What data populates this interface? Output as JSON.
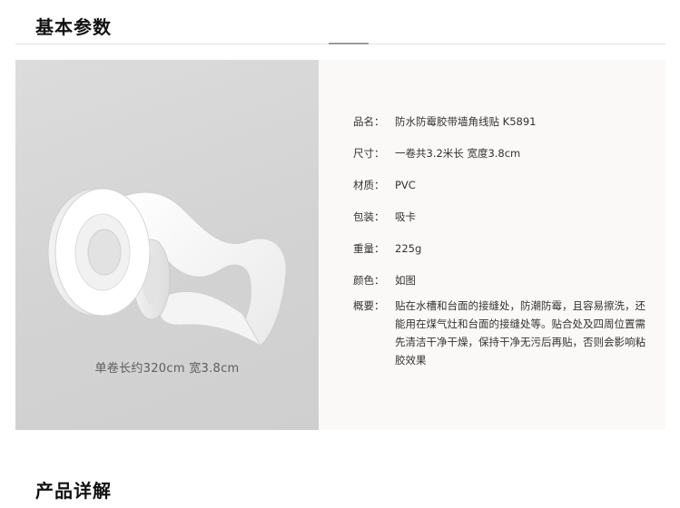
{
  "sections": {
    "basic_params_title": "基本参数",
    "product_details_title": "产品详解"
  },
  "photo": {
    "caption": "单卷长约320cm 宽3.8cm"
  },
  "specs": [
    {
      "key": "品名：",
      "value": "防水防霉胶带墙角线贴 K5891"
    },
    {
      "key": "尺寸：",
      "value": "一卷共3.2米长 宽度3.8cm"
    },
    {
      "key": "材质：",
      "value": "PVC"
    },
    {
      "key": "包装：",
      "value": "吸卡"
    },
    {
      "key": "重量：",
      "value": "225g"
    },
    {
      "key": "颜色：",
      "value": "如图"
    },
    {
      "key": "概要：",
      "value": "贴在水槽和台面的接缝处，防潮防霉，且容易擦洗，还能用在煤气灶和台面的接缝处等。贴合处及四周位置需先清洁干净干燥，保持干净无污后再贴，否则会影响粘胶效果"
    }
  ],
  "colors": {
    "panel_bg": "#faf9f7",
    "photo_bg": "#d6d6d6",
    "rule": "#e2e2e2"
  }
}
